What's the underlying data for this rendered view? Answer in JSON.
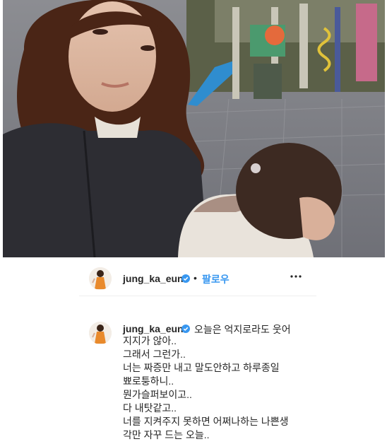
{
  "post": {
    "username": "jung_ka_eun",
    "follow_label": "팔로우",
    "separator": "•",
    "more_icon": "ellipsis-icon",
    "verified_icon": "verified-badge-icon",
    "photo_description_icon": "photo"
  },
  "caption": {
    "username": "jung_ka_eun",
    "first_line": "오늘은 억지로라도 웃어",
    "lines": [
      "지지가 않아..",
      "그래서 그런가..",
      "너는 짜증만 내고 말도안하고 하루종일",
      "뾰로퉁하니..",
      "뭔가슬퍼보이고..",
      "다 내탓같고..",
      "너를 지켜주지 못하면 어쩌나하는 나쁜생",
      "각만 자꾸 드는 오늘.."
    ]
  },
  "colors": {
    "link_blue": "#3897f0",
    "verified_blue": "#3897f0",
    "text": "#262626",
    "divider": "#efefef"
  }
}
